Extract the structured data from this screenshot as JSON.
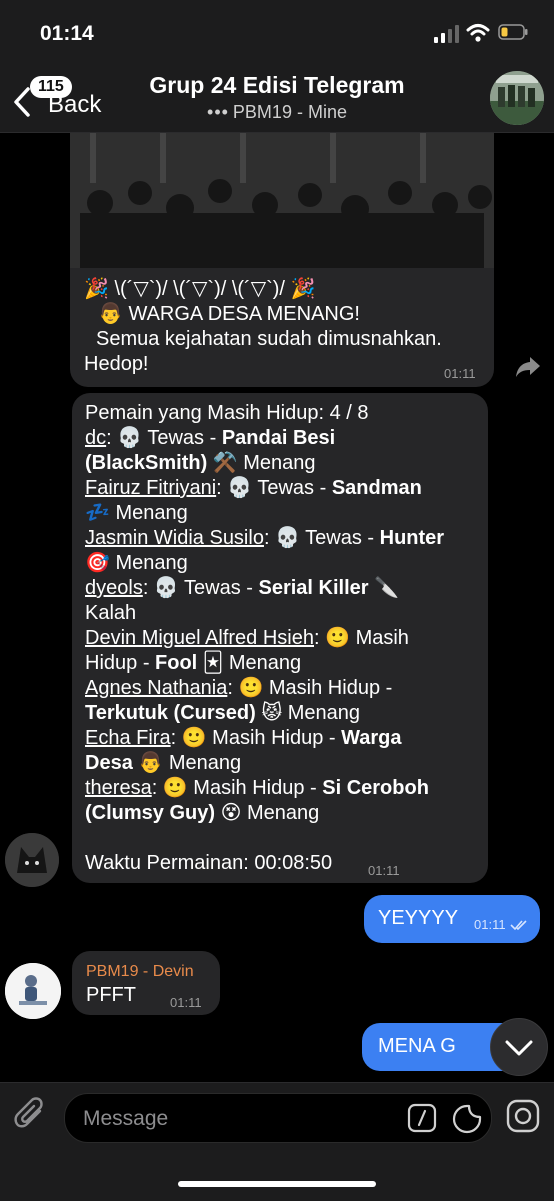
{
  "status": {
    "time": "01:14"
  },
  "header": {
    "back_label": "Back",
    "back_count": "115",
    "title": "Grup 24 Edisi Telegram",
    "subtitle_dots": "•••",
    "subtitle": "PBM19 - Mine"
  },
  "messages": {
    "photo_caption": {
      "line1": "🎉 \\(´▽`)/ \\(´▽`)/ \\(´▽`)/ 🎉",
      "line2": "👨 WARGA DESA MENANG!",
      "line3": "Semua kejahatan sudah dimusnahkan.",
      "line4": "Hedop!",
      "time": "01:11"
    },
    "results": {
      "header": "Pemain yang Masih Hidup: 4 / 8",
      "players": [
        {
          "name": "dc",
          "status": ": 💀 Tewas - ",
          "role": "Pandai Besi",
          "role2": "(BlackSmith)",
          "outcome": " ⚒️ Menang"
        },
        {
          "name": "Fairuz Fitriyani",
          "status": ": 💀 Tewas - ",
          "role": "Sandman",
          "outcome": "💤 Menang"
        },
        {
          "name": "Jasmin Widia Susilo",
          "status": ": 💀 Tewas - ",
          "role": "Hunter",
          "outcome": "🎯 Menang"
        },
        {
          "name": "dyeols",
          "status": ": 💀 Tewas - ",
          "role": "Serial Killer",
          "emoji": " 🔪",
          "outcome": "Kalah"
        },
        {
          "name": "Devin Miguel Alfred Hsieh",
          "status": ": 🙂 Masih",
          "status2": "Hidup - ",
          "role": "Fool",
          "outcome": " 🃏 Menang"
        },
        {
          "name": "Agnes Nathania",
          "status": ": 🙂 Masih Hidup -",
          "role": "Terkutuk (Cursed)",
          "outcome": " 😾 Menang"
        },
        {
          "name": "Echa Fira",
          "status": ": 🙂 Masih Hidup - ",
          "role": "Warga",
          "role2": "Desa",
          "outcome": " 👨 Menang"
        },
        {
          "name": "theresa",
          "status": ": 🙂 Masih Hidup - ",
          "role": "Si Ceroboh",
          "role2": "(Clumsy Guy)",
          "outcome": " 😵 Menang"
        }
      ],
      "footer": "Waktu Permainan: 00:08:50",
      "time": "01:11"
    },
    "out1": {
      "text": "YEYYYY",
      "time": "01:11"
    },
    "pfft": {
      "sender": "PBM19 - Devin",
      "text": "PFFT",
      "time": "01:11"
    },
    "out2": {
      "text": "MENA G"
    }
  },
  "input": {
    "placeholder": "Message"
  },
  "colors": {
    "accent": "#3c80f2",
    "sender_name": "#e98b4b",
    "bubble": "#262628"
  }
}
